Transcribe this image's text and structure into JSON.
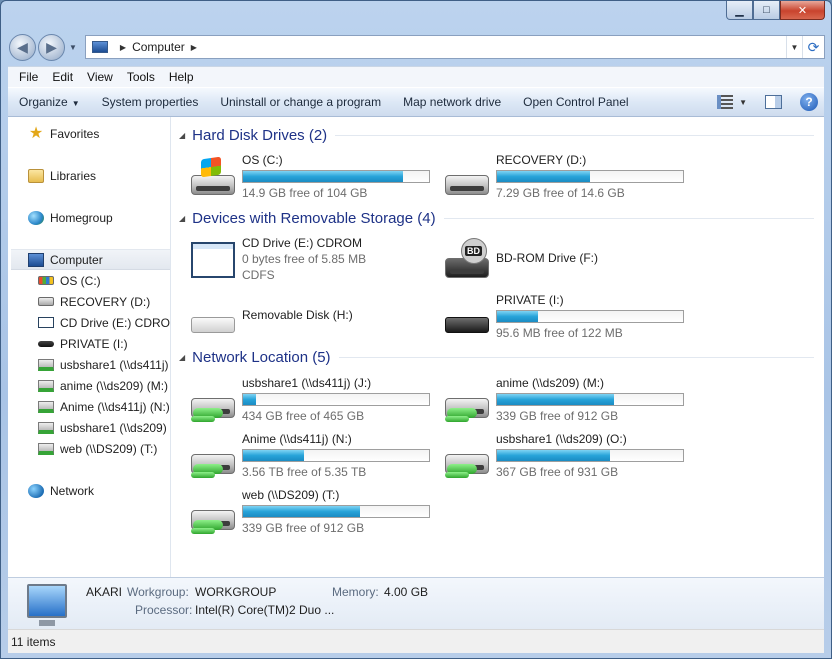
{
  "window": {
    "caption_buttons": {
      "minimize": "▁",
      "maximize": "□",
      "close": "✕"
    }
  },
  "address": {
    "back_glyph": "◀",
    "forward_glyph": "▶",
    "location": "Computer",
    "refresh_glyph": "⟳"
  },
  "menu": [
    "File",
    "Edit",
    "View",
    "Tools",
    "Help"
  ],
  "commands": {
    "organize": "Organize",
    "items": [
      "System properties",
      "Uninstall or change a program",
      "Map network drive",
      "Open Control Panel"
    ],
    "help": "?"
  },
  "nav": {
    "favorites": "Favorites",
    "libraries": "Libraries",
    "homegroup": "Homegroup",
    "computer": "Computer",
    "computer_children": [
      {
        "label": "OS (C:)",
        "icon": "os-drive-icon"
      },
      {
        "label": "RECOVERY (D:)",
        "icon": "hard-drive-icon"
      },
      {
        "label": "CD Drive (E:) CDROM",
        "icon": "cd-drive-icon"
      },
      {
        "label": "PRIVATE (I:)",
        "icon": "usb-drive-icon"
      },
      {
        "label": "usbshare1 (\\\\ds411j)",
        "icon": "network-drive-icon"
      },
      {
        "label": "anime (\\\\ds209) (M:)",
        "icon": "network-drive-icon"
      },
      {
        "label": "Anime (\\\\ds411j) (N:)",
        "icon": "network-drive-icon"
      },
      {
        "label": "usbshare1 (\\\\ds209) (",
        "icon": "network-drive-icon"
      },
      {
        "label": "web (\\\\DS209) (T:)",
        "icon": "network-drive-icon"
      }
    ],
    "network": "Network"
  },
  "groups": {
    "hard_disk": {
      "title": "Hard Disk Drives (2)",
      "items": [
        {
          "name": "OS (C:)",
          "free": "14.9 GB free of 104 GB",
          "used_fraction": 0.86
        },
        {
          "name": "RECOVERY (D:)",
          "free": "7.29 GB free of 14.6 GB",
          "used_fraction": 0.5
        }
      ]
    },
    "removable": {
      "title": "Devices with Removable Storage (4)",
      "items": [
        {
          "name": "CD Drive (E:) CDROM",
          "line2": "0 bytes free of 5.85 MB",
          "line3": "CDFS"
        },
        {
          "name": "BD-ROM Drive (F:)",
          "badge": "BD"
        },
        {
          "name": "Removable Disk (H:)"
        },
        {
          "name": "PRIVATE (I:)",
          "free": "95.6 MB free of 122 MB",
          "used_fraction": 0.22
        }
      ]
    },
    "network": {
      "title": "Network Location (5)",
      "items": [
        {
          "name": "usbshare1 (\\\\ds411j) (J:)",
          "free": "434 GB free of 465 GB",
          "used_fraction": 0.07
        },
        {
          "name": "anime (\\\\ds209) (M:)",
          "free": "339 GB free of 912 GB",
          "used_fraction": 0.63
        },
        {
          "name": "Anime (\\\\ds411j) (N:)",
          "free": "3.56 TB free of 5.35 TB",
          "used_fraction": 0.33
        },
        {
          "name": "usbshare1 (\\\\ds209) (O:)",
          "free": "367 GB free of 931 GB",
          "used_fraction": 0.61
        },
        {
          "name": "web (\\\\DS209) (T:)",
          "free": "339 GB free of 912 GB",
          "used_fraction": 0.63
        }
      ]
    }
  },
  "details": {
    "computer_name": "AKARI",
    "workgroup_label": "Workgroup:",
    "workgroup": "WORKGROUP",
    "memory_label": "Memory:",
    "memory": "4.00 GB",
    "processor_label": "Processor:",
    "processor": "Intel(R) Core(TM)2 Duo ..."
  },
  "status": {
    "items_count": "11 items"
  }
}
